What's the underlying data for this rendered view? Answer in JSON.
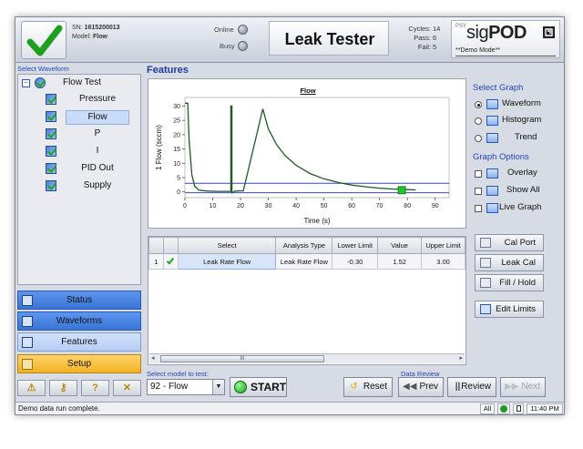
{
  "header": {
    "sn_label": "SN:",
    "sn_value": "1615200013",
    "model_label": "Model:",
    "model_value": "Flow",
    "online_label": "Online",
    "busy_label": "Busy",
    "title": "Leak Tester",
    "cycles_label": "Cycles:",
    "cycles_value": "14",
    "pass_label": "Pass:",
    "pass_value": "6",
    "fail_label": "Fail:",
    "fail_value": "5",
    "psy": "PSY",
    "brand_sig": "sig",
    "brand_pod": "POD",
    "demo_mode": "**Demo Mode**"
  },
  "waveform_panel": {
    "label": "Select Waveform",
    "root": "Flow Test",
    "items": [
      {
        "label": "Pressure",
        "selected": false
      },
      {
        "label": "Flow",
        "selected": true
      },
      {
        "label": "P",
        "selected": false
      },
      {
        "label": "I",
        "selected": false
      },
      {
        "label": "PID Out",
        "selected": false
      },
      {
        "label": "Supply",
        "selected": false
      }
    ]
  },
  "nav": {
    "status": "Status",
    "waveforms": "Waveforms",
    "features": "Features",
    "setup": "Setup"
  },
  "features": {
    "title": "Features"
  },
  "chart_data": {
    "type": "line",
    "title": "Flow",
    "xlabel": "Time (s)",
    "ylabel": "1 Flow (sccm)",
    "xlim": [
      0,
      95
    ],
    "ylim": [
      -2,
      33
    ],
    "xticks": [
      0,
      10,
      20,
      30,
      40,
      50,
      60,
      70,
      80,
      90
    ],
    "yticks": [
      0,
      5,
      10,
      15,
      20,
      25,
      30
    ],
    "limits": {
      "lower": -0.3,
      "upper": 3.0
    },
    "marker": {
      "x": 78,
      "y": 0.6
    },
    "series": [
      {
        "values_desc": "flow trace",
        "points": [
          [
            0,
            31
          ],
          [
            1,
            31
          ],
          [
            1.5,
            18
          ],
          [
            2.5,
            6
          ],
          [
            3.5,
            2
          ],
          [
            5,
            0.6
          ],
          [
            8,
            0.3
          ],
          [
            12,
            0.2
          ],
          [
            15,
            0.2
          ],
          [
            16.5,
            0.2
          ],
          [
            16.5,
            30
          ],
          [
            16.9,
            30
          ],
          [
            16.9,
            -0.3
          ],
          [
            18,
            0.3
          ],
          [
            21,
            0.4
          ],
          [
            28,
            29
          ],
          [
            30,
            22
          ],
          [
            33,
            16.5
          ],
          [
            36,
            12.7
          ],
          [
            40,
            9.3
          ],
          [
            45,
            6.4
          ],
          [
            50,
            4.6
          ],
          [
            55,
            3.3
          ],
          [
            60,
            2.4
          ],
          [
            65,
            1.8
          ],
          [
            70,
            1.3
          ],
          [
            75,
            1.0
          ],
          [
            80,
            0.8
          ],
          [
            83,
            0.7
          ]
        ]
      }
    ]
  },
  "select_graph": {
    "label": "Select Graph",
    "options": [
      {
        "label": "Waveform",
        "selected": true
      },
      {
        "label": "Histogram",
        "selected": false
      },
      {
        "label": "Trend",
        "selected": false
      }
    ]
  },
  "graph_options": {
    "label": "Graph Options",
    "options": [
      {
        "label": "Overlay"
      },
      {
        "label": "Show All"
      },
      {
        "label": "Live Graph"
      }
    ]
  },
  "side_buttons": {
    "cal_port": "Cal Port",
    "leak_cal": "Leak Cal",
    "fill_hold": "Fill / Hold",
    "edit_limits": "Edit Limits"
  },
  "table": {
    "headers": [
      "",
      "",
      "Select",
      "Analysis Type",
      "Lower Limit",
      "Value",
      "Upper Limit"
    ],
    "rows": [
      {
        "index": "1",
        "select": "Leak Rate Flow",
        "analysis_type": "Leak Rate Flow",
        "lower": "-0.30",
        "value": "1.52",
        "upper": "3.00"
      }
    ],
    "scroll_thumb": "III"
  },
  "bottom": {
    "model_label": "Select model to test:",
    "model_value": "92 - Flow",
    "start": "START",
    "reset": "Reset",
    "data_review": "Data Review",
    "prev": "Prev",
    "review": "Review",
    "next": "Next"
  },
  "statusbar": {
    "message": "Demo data run complete.",
    "all": "All",
    "time": "11:40 PM"
  }
}
